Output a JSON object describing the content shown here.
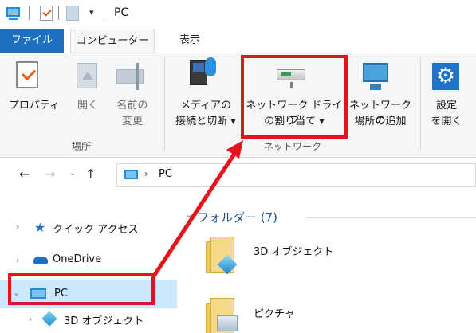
{
  "window": {
    "title": "PC",
    "quick_access_dropdown": "▾",
    "pc_icon": "pc-icon",
    "properties_icon": "properties-icon",
    "folder_icon": "folder-icon"
  },
  "ribbon_tabs": {
    "file": "ファイル",
    "computer": "コンピューター",
    "view": "表示"
  },
  "ribbon": {
    "location_group": {
      "label": "場所",
      "properties": "プロパティ",
      "open": "開く",
      "rename_line1": "名前の",
      "rename_line2": "変更"
    },
    "network_group": {
      "label": "ネットワーク",
      "media_line1": "メディアの",
      "media_line2": "接続と切断 ▾",
      "map_drive_line1": "ネットワーク ドライブ",
      "map_drive_line2": "の割り当て ▾",
      "add_location_line1": "ネットワークの",
      "add_location_line2": "場所の追加"
    },
    "settings": {
      "line1": "設定",
      "line2": "を開く",
      "icon": "gear-icon"
    }
  },
  "address_bar": {
    "back": "←",
    "forward": "→",
    "recent": "⌄",
    "up": "↑",
    "separator": "›",
    "path": "PC"
  },
  "nav_pane": {
    "items": [
      {
        "label": "クイック アクセス",
        "icon": "star-icon",
        "chevron": "›"
      },
      {
        "label": "OneDrive",
        "icon": "cloud-icon",
        "chevron": "›"
      },
      {
        "label": "PC",
        "icon": "pc-icon",
        "chevron": "⌄",
        "selected": true
      },
      {
        "label": "3D オブジェクト",
        "icon": "3d-objects-icon",
        "chevron": "›"
      }
    ]
  },
  "content": {
    "group_chevron": "⌄",
    "group_title": "フォルダー (7)",
    "folders": [
      {
        "label": "3D オブジェクト",
        "icon": "3d-objects-folder-icon"
      },
      {
        "label": "ピクチャ",
        "icon": "pictures-folder-icon"
      }
    ]
  },
  "annotation": {
    "highlight_color": "#e5131b"
  }
}
